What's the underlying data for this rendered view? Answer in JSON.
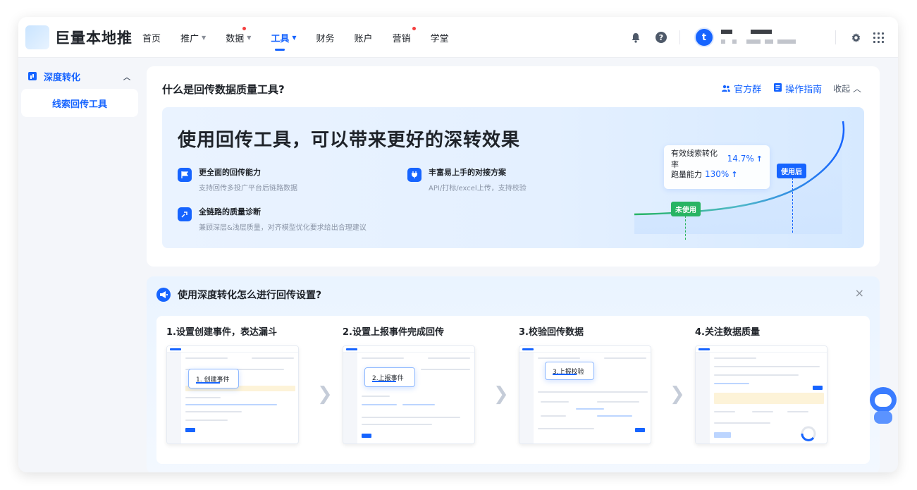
{
  "app": {
    "logo_text": "巨量本地推"
  },
  "nav": {
    "items": [
      {
        "label": "首页",
        "caret": false,
        "dot": false,
        "active": false
      },
      {
        "label": "推广",
        "caret": true,
        "dot": false,
        "active": false
      },
      {
        "label": "数据",
        "caret": true,
        "dot": true,
        "active": false
      },
      {
        "label": "工具",
        "caret": true,
        "dot": false,
        "active": true
      },
      {
        "label": "财务",
        "caret": false,
        "dot": false,
        "active": false
      },
      {
        "label": "账户",
        "caret": false,
        "dot": false,
        "active": false
      },
      {
        "label": "营销",
        "caret": false,
        "dot": true,
        "active": false
      },
      {
        "label": "学堂",
        "caret": false,
        "dot": false,
        "active": false
      }
    ],
    "caret_glyph": "▼",
    "avatar_letter": "t",
    "icons": [
      "bell-icon",
      "help-icon",
      "settings-icon",
      "apps-grid-icon"
    ],
    "help_glyph": "?"
  },
  "sidebar": {
    "group_label": "深度转化",
    "group_toggle": "︿",
    "active_item": "线索回传工具"
  },
  "intro": {
    "title": "什么是回传数据质量工具?",
    "actions": {
      "group": "官方群",
      "guide": "操作指南",
      "collapse": "收起 ︿"
    },
    "banner": {
      "headline": "使用回传工具，可以带来更好的深转效果",
      "features": [
        {
          "title": "更全面的回传能力",
          "desc": "支持回传多投广平台后链路数据"
        },
        {
          "title": "丰富易上手的对接方案",
          "desc": "API/打标/excel上传，支持校验"
        },
        {
          "title": "全链路的质量诊断",
          "desc": "兼顾深层&浅层质量，对齐模型优化要求给出合理建议"
        }
      ],
      "stats": [
        {
          "label": "有效线索转化率",
          "value": "14.7%"
        },
        {
          "label": "跑量能力",
          "value": "130%"
        }
      ],
      "tag_after": "使用后",
      "tag_before": "未使用"
    }
  },
  "setup": {
    "title": "使用深度转化怎么进行回传设置?",
    "close": "×",
    "steps": [
      {
        "title": "1.设置创建事件，表达漏斗",
        "popup": "1. 创建事件"
      },
      {
        "title": "2.设置上报事件完成回传",
        "popup": "2.上报事件"
      },
      {
        "title": "3.校验回传数据",
        "popup": "3.上报校验"
      },
      {
        "title": "4.关注数据质量",
        "popup": ""
      }
    ],
    "arrow_glyph": "❯"
  },
  "colors": {
    "accent": "#1664ff",
    "success": "#28b463",
    "badge": "#f53f3f"
  }
}
